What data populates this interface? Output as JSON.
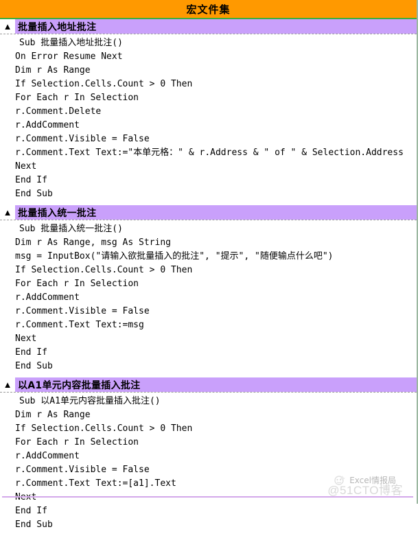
{
  "header": {
    "title": "宏文件集",
    "bg_color": "#ff9900",
    "underline_color": "#3fae3f"
  },
  "accent": {
    "section_bar_color": "#c9a0fb",
    "bottom_rule_color": "#d3a8ea"
  },
  "sections": [
    {
      "marker": "▲",
      "title": "批量插入地址批注",
      "code": [
        "Sub 批量插入地址批注()",
        "On Error Resume Next",
        "Dim r As Range",
        "If Selection.Cells.Count > 0 Then",
        "For Each r In Selection",
        "r.Comment.Delete",
        "r.AddComment",
        "r.Comment.Visible = False",
        "r.Comment.Text Text:=\"本单元格：\" & r.Address & \" of \" & Selection.Address",
        "Next",
        "End If",
        "End Sub"
      ]
    },
    {
      "marker": "▲",
      "title": "批量插入统一批注",
      "code": [
        "Sub 批量插入统一批注()",
        "Dim r As Range, msg As String",
        "msg = InputBox(\"请输入欲批量插入的批注\", \"提示\", \"随便输点什么吧\")",
        "If Selection.Cells.Count > 0 Then",
        "For Each r In Selection",
        "r.AddComment",
        "r.Comment.Visible = False",
        "r.Comment.Text Text:=msg",
        "Next",
        "End If",
        "End Sub"
      ]
    },
    {
      "marker": "▲",
      "title": "以A1单元内容批量插入批注",
      "code": [
        "Sub 以A1单元内容批量插入批注()",
        "Dim r As Range",
        "If Selection.Cells.Count > 0 Then",
        "For Each r In Selection",
        "r.AddComment",
        "r.Comment.Visible = False",
        "r.Comment.Text Text:=[a1].Text",
        "Next",
        "End If",
        "End Sub"
      ]
    }
  ],
  "footer": {
    "brand_text": "Excel情报局",
    "site_watermark": "@51CTO博客"
  }
}
